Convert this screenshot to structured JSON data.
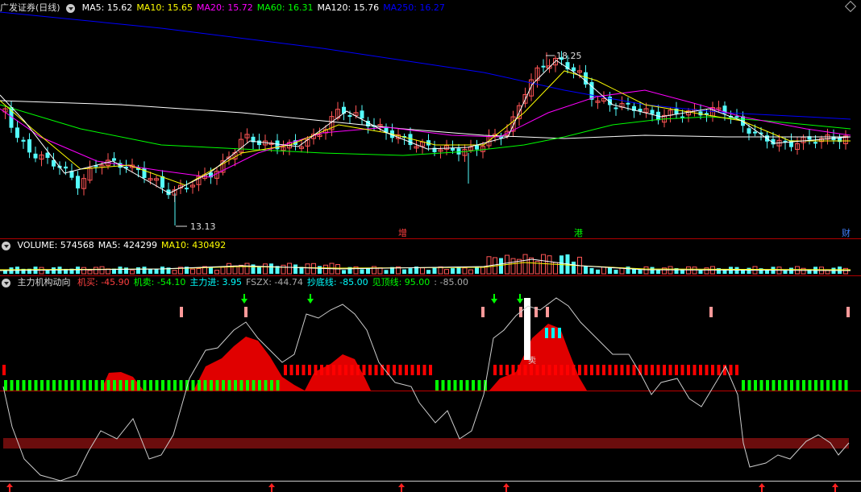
{
  "main_panel": {
    "title": "广发证券(日线)",
    "ma_labels": [
      {
        "text": "MA5: 15.62",
        "color": "#ffffff"
      },
      {
        "text": "MA10: 15.65",
        "color": "#ffff00"
      },
      {
        "text": "MA20: 15.72",
        "color": "#ff00ff"
      },
      {
        "text": "MA60: 16.31",
        "color": "#00ff00"
      },
      {
        "text": "MA120: 15.76",
        "color": "#ffffff"
      },
      {
        "text": "MA250: 16.27",
        "color": "#0000ff"
      }
    ],
    "high_label": "18.25",
    "low_label": "13.13",
    "markers": [
      {
        "text": "增",
        "color": "#ff4040"
      },
      {
        "text": "港",
        "color": "#00ff00"
      },
      {
        "text": "财",
        "color": "#4080ff"
      }
    ]
  },
  "volume_panel": {
    "labels": [
      {
        "text": "VOLUME: 574568",
        "color": "#ffffff"
      },
      {
        "text": "MA5: 424299",
        "color": "#ffffff"
      },
      {
        "text": "MA10: 430492",
        "color": "#ffff00"
      }
    ]
  },
  "indicator_panel": {
    "title": "主力机构动向",
    "labels": [
      {
        "text": "机买: -45.90",
        "color": "#ff4040"
      },
      {
        "text": "机卖: -54.10",
        "color": "#00ff00"
      },
      {
        "text": "主力进: 3.95",
        "color": "#00ffff"
      },
      {
        "text": "FSZX: -44.74",
        "color": "#aaaaaa"
      },
      {
        "text": "抄底线: -85.00",
        "color": "#00ffff"
      },
      {
        "text": "见顶线: 95.00",
        "color": "#00ff00"
      },
      {
        "text": ": -85.00",
        "color": "#aaaaaa"
      }
    ],
    "sell_label": "卖"
  },
  "colors": {
    "up": "#ff5555",
    "down": "#54fcfc",
    "red_area": "#e00000",
    "green_bar": "#00ff00",
    "pink_bar": "#ff9999"
  }
}
